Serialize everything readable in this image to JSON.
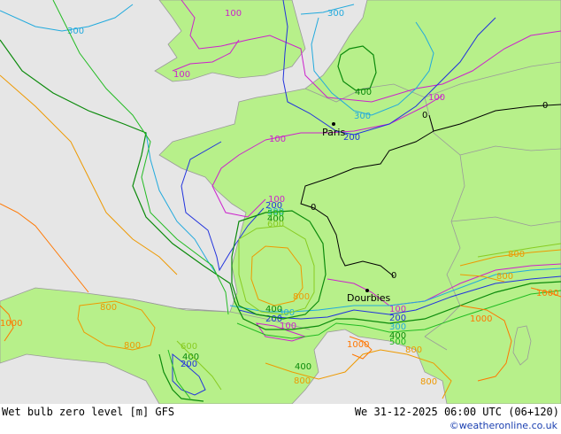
{
  "map": {
    "colors": {
      "sea": "#e6e6e6",
      "land": "#b7f08a",
      "border": "#9a9a9a",
      "c0": "#000000",
      "c100": "#cc22cc",
      "c200": "#2233dd",
      "c300": "#22aadd",
      "c400": "#0b8a0b",
      "c500": "#22bb22",
      "c600": "#88cc22",
      "c800": "#ee9900",
      "c1000": "#ff7700"
    },
    "cities": [
      {
        "name": "Paris"
      },
      {
        "name": "Dourbies"
      }
    ],
    "contour_labels": {
      "v0": "0",
      "v100": "100",
      "v200": "200",
      "v300": "300",
      "v400": "400",
      "v500": "500",
      "v600": "600",
      "v800": "800",
      "v1000": "1000"
    }
  },
  "footer": {
    "title": "Wet bulb zero level [m] GFS",
    "datetime": "We 31-12-2025 06:00 UTC (06+120)",
    "credit": "©weatheronline.co.uk"
  }
}
